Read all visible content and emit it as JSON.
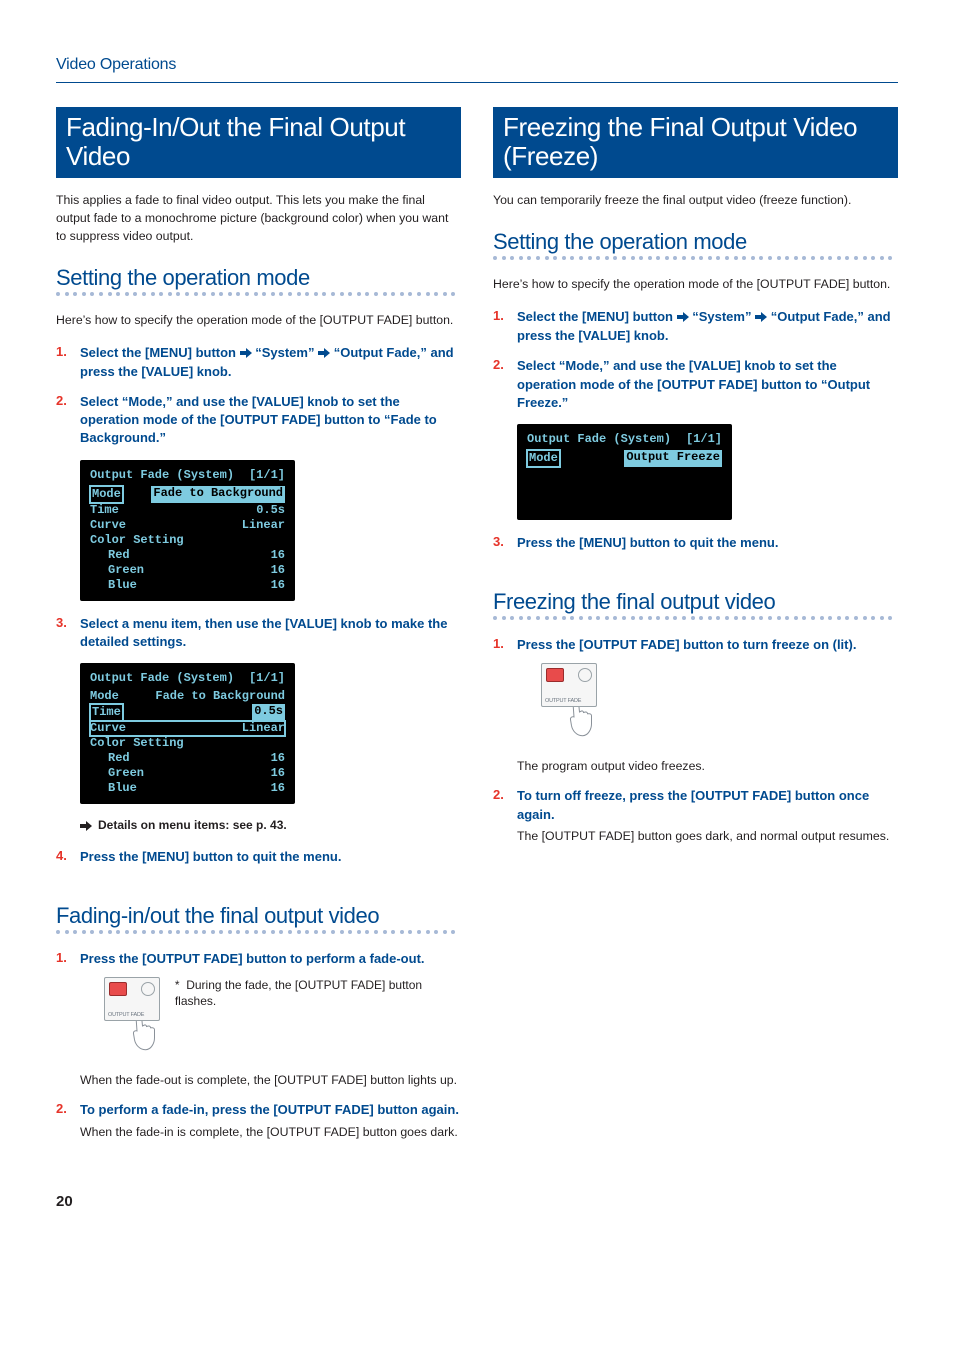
{
  "breadcrumb": "Video Operations",
  "page_number": "20",
  "left": {
    "banner": "Fading-In/Out the Final Output Video",
    "intro": "This applies a fade to final video output. This lets you make the final output fade to a monochrome picture (background color) when you want to suppress video output.",
    "section_a": {
      "heading": "Setting the operation mode",
      "lead": "Here’s how to specify the operation mode of the [OUTPUT FADE] button.",
      "steps": {
        "s1a": "Select the [MENU] button ",
        "s1b": " “System” ",
        "s1c": " “Output Fade,” and press the [VALUE] knob.",
        "s2": "Select “Mode,” and use the [VALUE] knob to set the operation mode of the [OUTPUT FADE] button to “Fade to Background.”",
        "s3": "Select a menu item, then use the [VALUE] knob to make the detailed settings.",
        "s4": "Press the [MENU] button to quit the menu."
      },
      "menu1": {
        "title": "Output Fade (System)",
        "page": "[1/1]",
        "rows": [
          {
            "l": "Mode",
            "r": "Fade to Background",
            "hl_left": true,
            "hl_right": true
          },
          {
            "l": "Time",
            "r": "0.5s"
          },
          {
            "l": "Curve",
            "r": "Linear"
          },
          {
            "l": "Color Setting",
            "r": ""
          },
          {
            "l": "Red",
            "r": "16",
            "indent": true
          },
          {
            "l": "Green",
            "r": "16",
            "indent": true
          },
          {
            "l": "Blue",
            "r": "16",
            "indent": true
          }
        ]
      },
      "menu2": {
        "title": "Output Fade (System)",
        "page": "[1/1]",
        "rows": [
          {
            "l": "Mode",
            "r": "Fade to Background"
          },
          {
            "l": "Time",
            "r": "0.5s",
            "hl_left": true,
            "hl_right": true
          },
          {
            "l": "Curve",
            "r": "Linear",
            "boxed": true
          },
          {
            "l": "Color Setting",
            "r": ""
          },
          {
            "l": "Red",
            "r": "16",
            "indent": true
          },
          {
            "l": "Green",
            "r": "16",
            "indent": true
          },
          {
            "l": "Blue",
            "r": "16",
            "indent": true
          }
        ]
      },
      "details": "Details on menu items: see p. 43."
    },
    "section_b": {
      "heading": "Fading-in/out the final output video",
      "steps": {
        "s1": "Press the [OUTPUT FADE] button to perform a fade-out.",
        "s1_note": "During the fade, the [OUTPUT FADE] button flashes.",
        "s1_after": "When the fade-out is complete, the [OUTPUT FADE] button lights up.",
        "s2": "To perform a fade-in, press the [OUTPUT FADE] button again.",
        "s2_after": "When the fade-in is complete, the [OUTPUT FADE] button goes dark."
      },
      "btn_label": "OUTPUT FADE"
    }
  },
  "right": {
    "banner": "Freezing the Final Output Video (Freeze)",
    "intro": "You can temporarily freeze the final output video (freeze function).",
    "section_a": {
      "heading": "Setting the operation mode",
      "lead": "Here’s how to specify the operation mode of the [OUTPUT FADE] button.",
      "steps": {
        "s1a": "Select the [MENU] button ",
        "s1b": " “System” ",
        "s1c": " “Output Fade,” and press the [VALUE] knob.",
        "s2": "Select “Mode,” and use the [VALUE] knob to set the operation mode of the [OUTPUT FADE] button to “Output Freeze.”",
        "s3": "Press the [MENU] button to quit the menu."
      },
      "menu": {
        "title": "Output Fade (System)",
        "page": "[1/1]",
        "rows": [
          {
            "l": "Mode",
            "r": "Output Freeze",
            "hl_left": true,
            "hl_right": true
          },
          {
            "l": " ",
            "r": ""
          },
          {
            "l": " ",
            "r": ""
          },
          {
            "l": " ",
            "r": ""
          }
        ]
      }
    },
    "section_b": {
      "heading": "Freezing the final output video",
      "steps": {
        "s1": "Press the [OUTPUT FADE] button to turn freeze on (lit).",
        "s1_after": "The program output video freezes.",
        "s2": "To turn off freeze, press the [OUTPUT FADE] button once again.",
        "s2_after": "The [OUTPUT FADE] button goes dark, and normal output resumes."
      },
      "btn_label": "OUTPUT FADE"
    }
  }
}
